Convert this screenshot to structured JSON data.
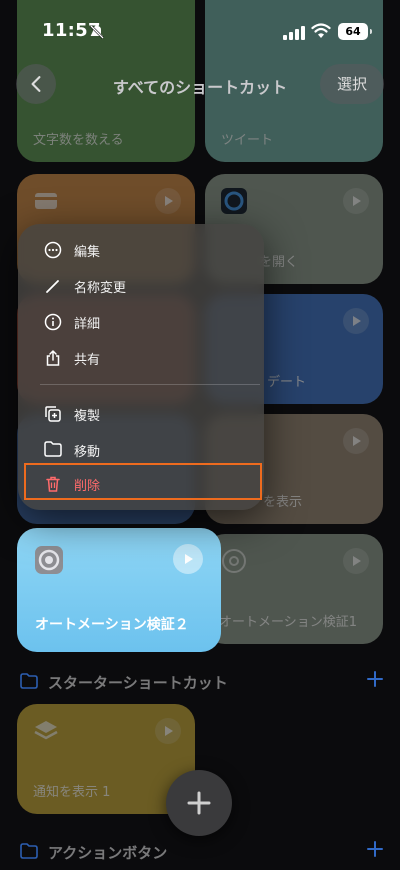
{
  "status": {
    "time": "11:57",
    "battery": "64"
  },
  "nav": {
    "title": "すべてのショートカット",
    "select_label": "選択"
  },
  "cards": {
    "count_chars": "文字数を数える",
    "tweet": "ツイート",
    "open_partial": "を開く",
    "update_partial": "デート",
    "show_partial": "を表示",
    "automation_1": "オートメーション検証1"
  },
  "menu": {
    "items": [
      {
        "label": "編集",
        "icon": "ellipsis-circle-icon"
      },
      {
        "label": "名称変更",
        "icon": "pencil-icon"
      },
      {
        "label": "詳細",
        "icon": "info-circle-icon"
      },
      {
        "label": "共有",
        "icon": "share-icon"
      },
      {
        "label": "複製",
        "icon": "duplicate-icon"
      },
      {
        "label": "移動",
        "icon": "folder-icon"
      },
      {
        "label": "削除",
        "icon": "trash-icon"
      }
    ]
  },
  "featured": {
    "label": "オートメーション検証２"
  },
  "sections": {
    "starter": "スターターショートカット",
    "action_button": "アクションボタン"
  },
  "notify_card": {
    "label": "通知を表示 1"
  },
  "colors": {
    "danger": "#ff6b6b",
    "highlight_border": "#ee6b1e",
    "featured_blue": "#7ccaf0",
    "accent_blue": "#3b82f6"
  }
}
